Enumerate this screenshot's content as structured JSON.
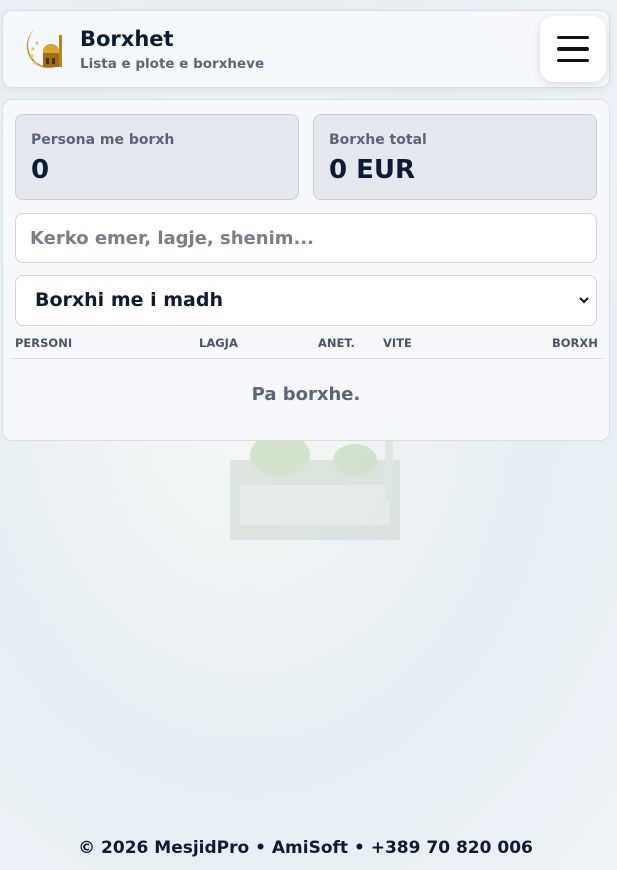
{
  "header": {
    "title": "Borxhet",
    "subtitle": "Lista e plote e borxheve",
    "logo_icon": "mosque-crescent-logo-icon",
    "menu_icon": "hamburger-menu-icon"
  },
  "stats": [
    {
      "label": "Persona me borxh",
      "value": "0"
    },
    {
      "label": "Borxhe total",
      "value": "0 EUR"
    }
  ],
  "search": {
    "placeholder": "Kerko emer, lagje, shenim...",
    "value": ""
  },
  "sort_select": {
    "selected": "Borxhi me i madh"
  },
  "table": {
    "columns": [
      "PERSONI",
      "LAGJA",
      "ANET.",
      "VITE",
      "BORXH"
    ],
    "rows": [],
    "empty_text": "Pa borxhe."
  },
  "footer": {
    "text": "© 2026 MesjidPro  •  AmiSoft  •  +389 70 820 006"
  },
  "colors": {
    "accent": "#0f1b33",
    "muted": "#5a6577",
    "card": "#e5e9ef",
    "logo_gold": "#c8962a",
    "watermark_green": "#7bb661"
  }
}
